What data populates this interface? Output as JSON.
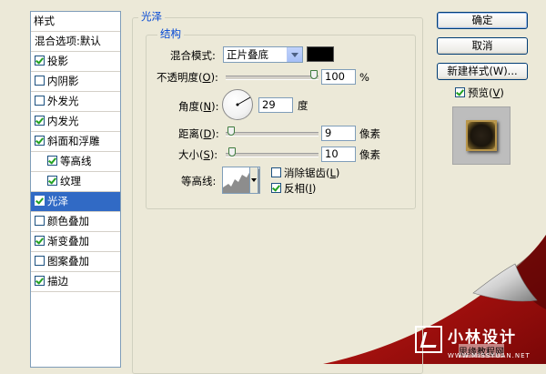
{
  "styles_panel": {
    "header": "样式",
    "blend_options": "混合选项:默认",
    "items": [
      {
        "label": "投影",
        "checked": true,
        "sub": false,
        "selected": false
      },
      {
        "label": "内阴影",
        "checked": false,
        "sub": false,
        "selected": false
      },
      {
        "label": "外发光",
        "checked": false,
        "sub": false,
        "selected": false
      },
      {
        "label": "内发光",
        "checked": true,
        "sub": false,
        "selected": false
      },
      {
        "label": "斜面和浮雕",
        "checked": true,
        "sub": false,
        "selected": false
      },
      {
        "label": "等高线",
        "checked": true,
        "sub": true,
        "selected": false
      },
      {
        "label": "纹理",
        "checked": true,
        "sub": true,
        "selected": false
      },
      {
        "label": "光泽",
        "checked": true,
        "sub": false,
        "selected": true
      },
      {
        "label": "颜色叠加",
        "checked": false,
        "sub": false,
        "selected": false
      },
      {
        "label": "渐变叠加",
        "checked": true,
        "sub": false,
        "selected": false
      },
      {
        "label": "图案叠加",
        "checked": false,
        "sub": false,
        "selected": false
      },
      {
        "label": "描边",
        "checked": true,
        "sub": false,
        "selected": false
      }
    ]
  },
  "satin": {
    "title": "光泽",
    "structure_title": "结构",
    "blend_mode_label": "混合模式:",
    "blend_mode_value": "正片叠底",
    "blend_color": "#000000",
    "opacity_label_pre": "不透明度(",
    "opacity_key": "O",
    "opacity_label_post": "):",
    "opacity_value": "100",
    "opacity_unit": "%",
    "angle_label_pre": "角度(",
    "angle_key": "N",
    "angle_label_post": "):",
    "angle_value": "29",
    "angle_unit": "度",
    "distance_label_pre": "距离(",
    "distance_key": "D",
    "distance_label_post": "):",
    "distance_value": "9",
    "distance_unit": "像素",
    "size_label_pre": "大小(",
    "size_key": "S",
    "size_label_post": "):",
    "size_value": "10",
    "size_unit": "像素",
    "contour_label": "等高线:",
    "anti_alias_label_pre": "消除锯齿(",
    "anti_alias_key": "L",
    "anti_alias_label_post": ")",
    "anti_alias_checked": false,
    "invert_label_pre": "反相(",
    "invert_key": "I",
    "invert_label_post": ")",
    "invert_checked": true
  },
  "buttons": {
    "ok": "确定",
    "cancel": "取消",
    "new_style": "新建样式(W)...",
    "preview_label_pre": "预览(",
    "preview_key": "V",
    "preview_label_post": ")",
    "preview_checked": true
  },
  "watermark": {
    "brand": "小林设计",
    "site": "思缘教程网",
    "url": "WWW.MISSYUAN.NET"
  }
}
